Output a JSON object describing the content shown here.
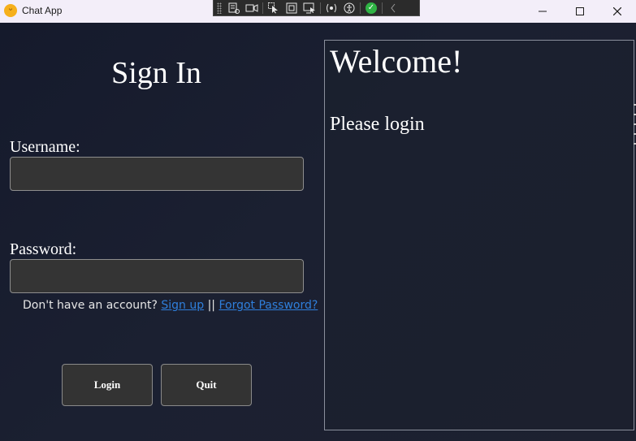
{
  "window": {
    "title": "Chat App",
    "app_icon": "emoji-face-icon",
    "controls": [
      "minimize-icon",
      "maximize-icon",
      "close-icon"
    ]
  },
  "devtools_toolbar": {
    "icons": [
      "select-element-icon",
      "video-icon",
      "pointer-icon",
      "frame-icon",
      "screen-icon",
      "hot-reload-icon",
      "accessibility-icon",
      "check-icon",
      "collapse-icon"
    ]
  },
  "login": {
    "title": "Sign In",
    "username_label": "Username:",
    "username_value": "",
    "password_label": "Password:",
    "password_value": "",
    "no_account_text": "Don't have an account?",
    "signup_link": "Sign up",
    "separator": "||",
    "forgot_link": "Forgot Password?",
    "login_button": "Login",
    "quit_button": "Quit"
  },
  "welcome_panel": {
    "heading": "Welcome!",
    "message": "Please login"
  },
  "colors": {
    "background": "#1a1f2f",
    "input_bg": "#343434",
    "link": "#2f7fdc",
    "titlebar": "#f3eef9"
  }
}
